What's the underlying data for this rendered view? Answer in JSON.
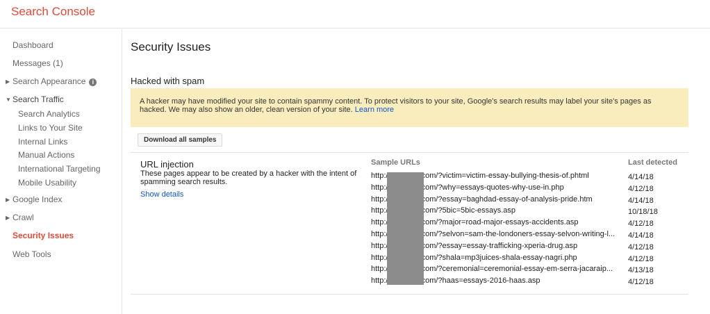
{
  "app": {
    "title": "Search Console"
  },
  "sidebar": {
    "dashboard": "Dashboard",
    "messages": "Messages (1)",
    "search_appearance": "Search Appearance",
    "search_traffic": "Search Traffic",
    "search_traffic_items": [
      "Search Analytics",
      "Links to Your Site",
      "Internal Links",
      "Manual Actions",
      "International Targeting",
      "Mobile Usability"
    ],
    "google_index": "Google Index",
    "crawl": "Crawl",
    "security_issues": "Security Issues",
    "web_tools": "Web Tools"
  },
  "page": {
    "title": "Security Issues",
    "section_title": "Hacked with spam",
    "warning_text": "A hacker may have modified your site to contain spammy content. To protect visitors to your site, Google's search results may label your site's pages as hacked. We may also show an older, clean version of your site.",
    "warning_link": "Learn more",
    "download_button": "Download all samples"
  },
  "issue": {
    "title": "URL injection",
    "description": "These pages appear to be created by a hacker with the intent of spamming search results.",
    "show_details": "Show details",
    "col_sample_urls": "Sample URLs",
    "col_last_detected": "Last detected",
    "rows": [
      {
        "prefix": "http://",
        "suffix": ".com/?victim=victim-essay-bullying-thesis-of.phtml",
        "date": "4/14/18"
      },
      {
        "prefix": "http://",
        "suffix": ".com/?why=essays-quotes-why-use-in.php",
        "date": "4/12/18"
      },
      {
        "prefix": "http://",
        "suffix": ".com/?essay=baghdad-essay-of-analysis-pride.htm",
        "date": "4/14/18"
      },
      {
        "prefix": "http://",
        "suffix": ".com/?5bic=5bic-essays.asp",
        "date": "10/18/18"
      },
      {
        "prefix": "http://",
        "suffix": ".com/?major=road-major-essays-accidents.asp",
        "date": "4/12/18"
      },
      {
        "prefix": "http://",
        "suffix": ".com/?selvon=sam-the-londoners-essay-selvon-writing-l...",
        "date": "4/14/18"
      },
      {
        "prefix": "http://",
        "suffix": ".com/?essay=essay-trafficking-xperia-drug.asp",
        "date": "4/12/18"
      },
      {
        "prefix": "http://",
        "suffix": ".com/?shala=mp3juices-shala-essay-nagri.php",
        "date": "4/12/18"
      },
      {
        "prefix": "http://",
        "suffix": ".com/?ceremonial=ceremonial-essay-em-serra-jacaraip...",
        "date": "4/13/18"
      },
      {
        "prefix": "http://",
        "suffix": ".com/?haas=essays-2016-haas.asp",
        "date": "4/12/18"
      }
    ]
  },
  "icons": {
    "caret_right": "caret-right-icon",
    "caret_down": "caret-down-icon",
    "info": "info-icon"
  }
}
